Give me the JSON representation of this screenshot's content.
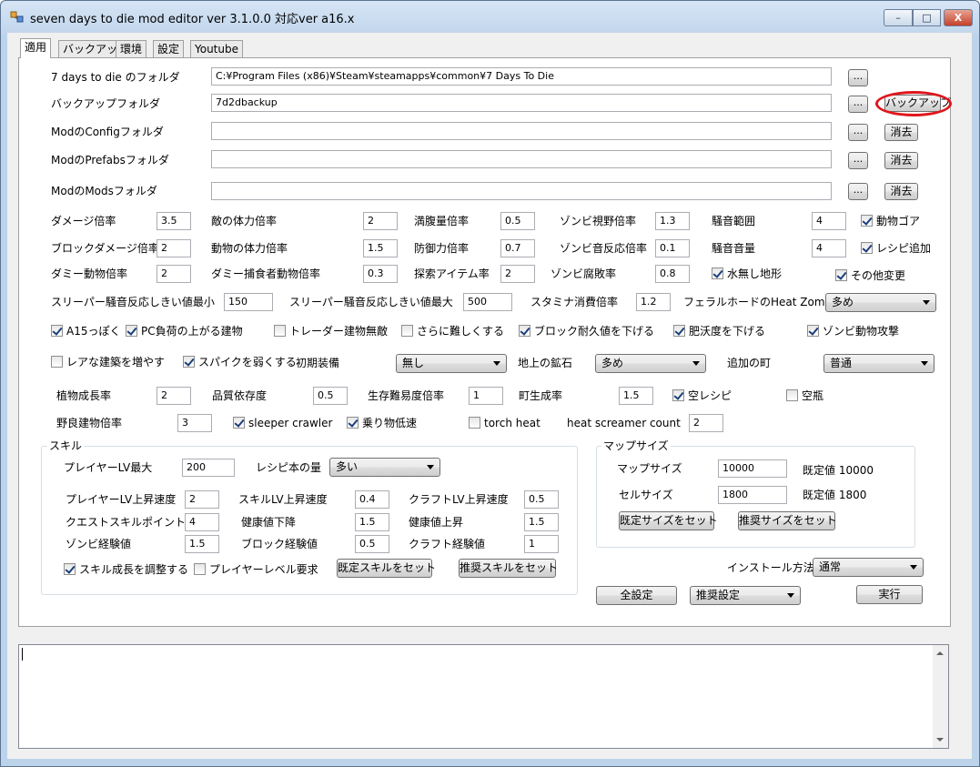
{
  "window": {
    "title": "seven days to die mod editor ver 3.1.0.0 対応ver a16.x",
    "minimize": "–",
    "maximize": "□",
    "close": "X"
  },
  "tabs": [
    "適用",
    "バックアップ",
    "環境",
    "設定",
    "Youtube"
  ],
  "folders": {
    "game_label": "7 days to die のフォルダ",
    "game_value": "C:¥Program Files (x86)¥Steam¥steamapps¥common¥7 Days To Die",
    "backup_label": "バックアップフォルダ",
    "backup_value": "7d2dbackup",
    "config_label": "ModのConfigフォルダ",
    "config_value": "",
    "prefabs_label": "ModのPrefabsフォルダ",
    "prefabs_value": "",
    "mods_label": "ModのModsフォルダ",
    "mods_value": "",
    "browse": "...",
    "backup_button": "バックアップ",
    "clear_button": "消去"
  },
  "rows": {
    "r1": [
      {
        "label": "ダメージ倍率",
        "value": "3.5"
      },
      {
        "label": "敵の体力倍率",
        "value": "2"
      },
      {
        "label": "満腹量倍率",
        "value": "0.5"
      },
      {
        "label": "ゾンビ視野倍率",
        "value": "1.3"
      },
      {
        "label": "騒音範囲",
        "value": "4"
      }
    ],
    "r1_check": "動物ゴア",
    "r2": [
      {
        "label": "ブロックダメージ倍率",
        "value": "2"
      },
      {
        "label": "動物の体力倍率",
        "value": "1.5"
      },
      {
        "label": "防御力倍率",
        "value": "0.7"
      },
      {
        "label": "ゾンビ音反応倍率",
        "value": "0.1"
      },
      {
        "label": "騒音音量",
        "value": "4"
      }
    ],
    "r2_check": "レシピ追加",
    "r3": [
      {
        "label": "ダミー動物倍率",
        "value": "2"
      },
      {
        "label": "ダミー捕食者動物倍率",
        "value": "0.3"
      },
      {
        "label": "探索アイテム率",
        "value": "2"
      },
      {
        "label": "ゾンビ腐敗率",
        "value": "0.8"
      }
    ],
    "r3_check1": "水無し地形",
    "r3_check2": "その他変更",
    "r4": [
      {
        "label": "スリーパー騒音反応しきい値最小",
        "value": "150"
      },
      {
        "label": "スリーパー騒音反応しきい値最大",
        "value": "500"
      },
      {
        "label": "スタミナ消費倍率",
        "value": "1.2"
      }
    ],
    "r4_combo_label": "フェラルホードのHeat Zombie量",
    "r4_combo_value": "多め",
    "r5": [
      "A15っぽく",
      "PC負荷の上がる建物",
      "トレーダー建物無敵",
      "さらに難しくする",
      "ブロック耐久値を下げる",
      "肥沃度を下げる",
      "ゾンビ動物攻撃"
    ],
    "r6_check1": "レアな建築を増やす",
    "r6_check2": "スパイクを弱くする",
    "r6_equip_label": "初期装備",
    "r6_equip_value": "無し",
    "r6_ore_label": "地上の鉱石",
    "r6_ore_value": "多め",
    "r6_town_label": "追加の町",
    "r6_town_value": "普通",
    "r7": [
      {
        "label": "植物成長率",
        "value": "2"
      },
      {
        "label": "品質依存度",
        "value": "0.5"
      },
      {
        "label": "生存難易度倍率",
        "value": "1"
      },
      {
        "label": "町生成率",
        "value": "1.5"
      }
    ],
    "r7_check1": "空レシピ",
    "r7_check2": "空瓶",
    "r8_label": "野良建物倍率",
    "r8_value": "3",
    "r8_check1": "sleeper crawler",
    "r8_check2": "乗り物低速",
    "r8_check3": "torch heat",
    "r8_hs_label": "heat screamer count",
    "r8_hs_value": "2"
  },
  "skill": {
    "title": "スキル",
    "player_lv_max_label": "プレイヤーLV最大",
    "player_lv_max_value": "200",
    "recipe_label": "レシピ本の量",
    "recipe_value": "多い",
    "grid": [
      {
        "label": "プレイヤーLV上昇速度",
        "value": "2"
      },
      {
        "label": "スキルLV上昇速度",
        "value": "0.4"
      },
      {
        "label": "クラフトLV上昇速度",
        "value": "0.5"
      },
      {
        "label": "クエストスキルポイント",
        "value": "4"
      },
      {
        "label": "健康値下降",
        "value": "1.5"
      },
      {
        "label": "健康値上昇",
        "value": "1.5"
      },
      {
        "label": "ゾンビ経験値",
        "value": "1.5"
      },
      {
        "label": "ブロック経験値",
        "value": "0.5"
      },
      {
        "label": "クラフト経験値",
        "value": "1"
      }
    ],
    "adjust_check": "スキル成長を調整する",
    "level_req_check": "プレイヤーレベル要求",
    "default_skill_button": "既定スキルをセット",
    "recommended_skill_button": "推奨スキルをセット"
  },
  "map": {
    "title": "マップサイズ",
    "map_label": "マップサイズ",
    "map_value": "10000",
    "map_default": "既定値 10000",
    "cell_label": "セルサイズ",
    "cell_value": "1800",
    "cell_default": "既定値 1800",
    "default_size_button": "既定サイズをセット",
    "recommended_size_button": "推奨サイズをセット"
  },
  "install": {
    "label": "インストール方法",
    "value": "通常"
  },
  "bottom": {
    "all_settings_button": "全設定",
    "preset_value": "推奨設定",
    "run_button": "実行"
  },
  "colors": {
    "highlight": "#e0161c",
    "titlebar": "#c2d6ec"
  }
}
